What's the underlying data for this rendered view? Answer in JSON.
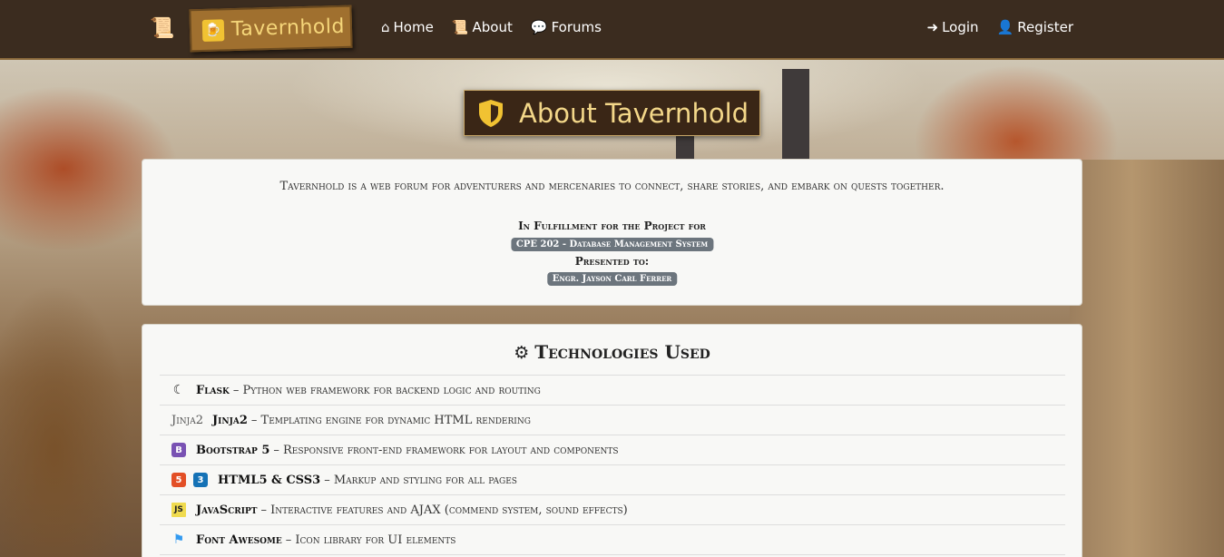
{
  "navbar": {
    "brand": "Tavernhold",
    "links": [
      {
        "label": "Home",
        "icon": "home-icon"
      },
      {
        "label": "About",
        "icon": "scroll-icon"
      },
      {
        "label": "Forums",
        "icon": "comments-icon"
      }
    ],
    "auth": [
      {
        "label": "Login",
        "icon": "sign-in-icon"
      },
      {
        "label": "Register",
        "icon": "user-plus-icon"
      }
    ]
  },
  "page_title": "About Tavernhold",
  "about": {
    "description": "Tavernhold is a web forum for adventurers and mercenaries to connect, share stories, and embark on quests together.",
    "fulfillment_label": "In Fulfillment for the Project for",
    "course_badge": "CPE 202 - Database Management System",
    "presented_label": "Presented to:",
    "instructor_badge": "Engr. Jayson Carl Ferrer"
  },
  "technologies": {
    "heading": "Technologies Used",
    "items": [
      {
        "name": "Flask",
        "desc": "– Python web framework for backend logic and routing",
        "icon": "flask-icon"
      },
      {
        "prefix": "Jinja2",
        "name": "Jinja2",
        "desc": "– Templating engine for dynamic HTML rendering",
        "icon": "jinja-text"
      },
      {
        "name": "Bootstrap 5",
        "desc": "– Responsive front-end framework for layout and components",
        "icon": "bootstrap-icon"
      },
      {
        "name": "HTML5 & CSS3",
        "desc": "– Markup and styling for all pages",
        "icon": "html5-css3-icon"
      },
      {
        "name": "JavaScript",
        "desc": "– Interactive features and AJAX (commend system, sound effects)",
        "icon": "javascript-icon"
      },
      {
        "name": "Font Awesome",
        "desc": "– Icon library for UI elements",
        "icon": "font-awesome-icon"
      }
    ]
  },
  "colors": {
    "navbar_bg": "#3b2c1f",
    "brand_bg": "#a0702f",
    "title_bg": "#3a2616",
    "title_text": "#f3d789",
    "badge_bg": "#6c757d"
  }
}
